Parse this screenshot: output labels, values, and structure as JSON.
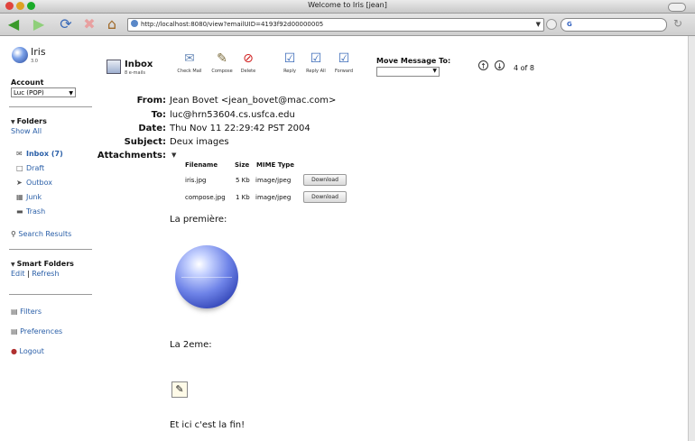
{
  "window": {
    "title": "Welcome to Iris [jean]"
  },
  "browser": {
    "url": "http://localhost:8080/view?emailUID=4193f92d00000005",
    "search_logo": "G"
  },
  "sidebar": {
    "brand": "Iris",
    "version": "3.0",
    "account_label": "Account",
    "account_value": "Luc (POP)",
    "folders_label": "Folders",
    "show_all": "Show All",
    "folders": [
      {
        "label": "Inbox (7)",
        "icon": "inbox-icon"
      },
      {
        "label": "Draft",
        "icon": "draft-icon"
      },
      {
        "label": "Outbox",
        "icon": "outbox-icon"
      },
      {
        "label": "Junk",
        "icon": "junk-icon"
      },
      {
        "label": "Trash",
        "icon": "trash-icon"
      }
    ],
    "search_results": "Search Results",
    "smart_folders_label": "Smart Folders",
    "edit": "Edit",
    "separator": "|",
    "refresh": "Refresh",
    "filters": "Filters",
    "preferences": "Preferences",
    "logout": "Logout"
  },
  "header": {
    "inbox_title": "Inbox",
    "inbox_sub": "8 e-mails",
    "tools": [
      {
        "label": "Check Mail",
        "icon": "check-mail-icon"
      },
      {
        "label": "Compose",
        "icon": "compose-icon"
      },
      {
        "label": "Delete",
        "icon": "delete-icon"
      },
      {
        "label": "Reply",
        "icon": "reply-icon"
      },
      {
        "label": "Reply All",
        "icon": "reply-all-icon"
      },
      {
        "label": "Forward",
        "icon": "forward-icon"
      }
    ],
    "move_label": "Move Message To:",
    "counter": "4 of 8"
  },
  "message": {
    "from_label": "From:",
    "from": "Jean Bovet <jean_bovet@mac.com>",
    "to_label": "To:",
    "to": "luc@hrn53604.cs.usfca.edu",
    "date_label": "Date:",
    "date": "Thu Nov 11 22:29:42 PST 2004",
    "subject_label": "Subject:",
    "subject": "Deux images",
    "attachments_label": "Attachments:",
    "columns": [
      "Filename",
      "Size",
      "MIME Type"
    ],
    "attachments": [
      {
        "filename": "iris.jpg",
        "size": "5 Kb",
        "mime": "image/jpeg",
        "action": "Download"
      },
      {
        "filename": "compose.jpg",
        "size": "1 Kb",
        "mime": "image/jpeg",
        "action": "Download"
      }
    ],
    "body": [
      "La première:",
      "La 2eme:",
      "Et ici c'est la fin!"
    ]
  }
}
